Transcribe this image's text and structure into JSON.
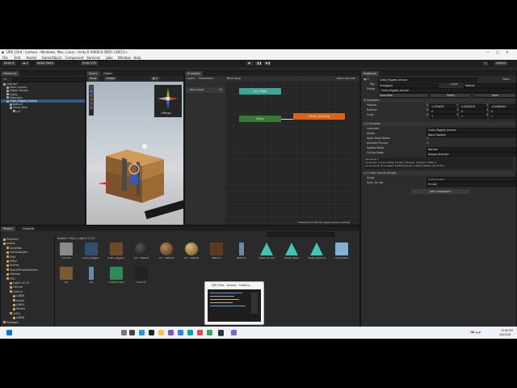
{
  "window": {
    "title": "URP_03rd - Lecture - Windows, Mac, Linux - Unity 6 (6000.0.58f2) <DX11>",
    "menus": [
      "File",
      "Edit",
      "Assets",
      "GameObject",
      "Component",
      "Services",
      "Jobs",
      "Window",
      "Help"
    ]
  },
  "toolbar": {
    "account": "Unity 6",
    "asset_store": "Asset Store",
    "unity_version_control": "Unity VCS",
    "layout": "Layout"
  },
  "hierarchy": {
    "tab": "Hierarchy",
    "items": [
      {
        "label": "Lecture*",
        "indent": 0,
        "selected": false
      },
      {
        "label": "Main Camera",
        "indent": 1,
        "selected": false
      },
      {
        "label": "Global Volume",
        "indent": 1,
        "selected": false
      },
      {
        "label": "Lights",
        "indent": 1,
        "selected": false
      },
      {
        "label": "Geometry",
        "indent": 1,
        "selected": false
      },
      {
        "label": "Crate_Rigged_lecture",
        "indent": 1,
        "selected": true
      },
      {
        "label": "Bottom",
        "indent": 2,
        "selected": false
      },
      {
        "label": "Chest_Root",
        "indent": 2,
        "selected": false
      },
      {
        "label": "Lid",
        "indent": 3,
        "selected": false
      }
    ]
  },
  "scene": {
    "tabs": [
      "Scene",
      "Game"
    ],
    "pivot": "Pivot",
    "global": "Global",
    "persp": "<Persp"
  },
  "animator": {
    "tab": "Animator",
    "subtabs": [
      "Layers",
      "Parameters"
    ],
    "base_layer": "Base Layer",
    "base_layer_item": "Base Layer",
    "auto_live_link": "Auto Live Link",
    "nodes": {
      "any_state": "Any State",
      "entry": "Entry",
      "chest_opening": "Chest_Opening"
    },
    "footer_path": "VSA/Lab15-12-12/Crate_Rigged_lecture.controller"
  },
  "inspector": {
    "tab": "Inspector",
    "object_name": "Crate_Rigged_lecture",
    "static": "Static",
    "tag_label": "Tag",
    "tag_value": "Untagged",
    "layer_label": "Layer",
    "layer_value": "Default",
    "prefab_label": "Prefab",
    "prefab_value": "Crate_Rigged_lecture",
    "overrides": "Overrides",
    "select": "Select",
    "open": "Open",
    "transform": {
      "header": "Transform",
      "position": {
        "label": "Position",
        "x": "1.570639",
        "y": "0.0000039",
        "z": "-0.0489649"
      },
      "rotation": {
        "label": "Rotation",
        "x": "0",
        "y": "0",
        "z": "0"
      },
      "scale": {
        "label": "Scale",
        "x": "1",
        "y": "1",
        "z": "1"
      }
    },
    "animator_comp": {
      "header": "Animator",
      "controller": {
        "label": "Controller",
        "value": "Crate_Rigged_lecture"
      },
      "avatar": {
        "label": "Avatar",
        "value": "None (Avatar)"
      },
      "apply_root_motion": "Apply Root Motion",
      "animate_physics": "Animate Physics",
      "update_mode": {
        "label": "Update Mode",
        "value": "Normal"
      },
      "culling_mode": {
        "label": "Culling Mode",
        "value": "Always Animate"
      },
      "clip_info": "Clip Count: 1\nCurves Pos: 0 Quat: 0 Euler: 0 Scale: 0 Muscles: 0 Generic: 0 PPtr: 0\nCurves Count: 32 Constant: 8 (66.8%) Dense: 0 (0.0%) Stream: 24 (33.3%)"
    },
    "script_comp": {
      "header": "Crate Control (Script)",
      "script": {
        "label": "Script",
        "value": "CrateControl"
      },
      "anim_on_act": {
        "label": "Anim_On Act",
        "value": "On Act"
      }
    },
    "add_component": "Add Component"
  },
  "project": {
    "tabs": [
      "Project",
      "Console"
    ],
    "tree": [
      {
        "label": "Favorites",
        "indent": 0
      },
      {
        "label": "Assets",
        "indent": 0
      },
      {
        "label": "AzureTool",
        "indent": 1
      },
      {
        "label": "ConvexAssets",
        "indent": 1
      },
      {
        "label": "Shot",
        "indent": 1
      },
      {
        "label": "Editor",
        "indent": 1
      },
      {
        "label": "Scenes",
        "indent": 1
      },
      {
        "label": "SpaceTemplateAssets",
        "indent": 1
      },
      {
        "label": "Settings",
        "indent": 1
      },
      {
        "label": "VSA",
        "indent": 1
      },
      {
        "label": "Lab15-12-12",
        "indent": 2
      },
      {
        "label": "Lecture",
        "indent": 2
      },
      {
        "label": "Lecture",
        "indent": 2
      },
      {
        "label": "LAB09",
        "indent": 3
      },
      {
        "label": "Assets",
        "indent": 3
      },
      {
        "label": "LAB09",
        "indent": 3
      },
      {
        "label": "Models",
        "indent": 3
      },
      {
        "label": "Lab11",
        "indent": 2
      },
      {
        "label": "LAB08",
        "indent": 3
      },
      {
        "label": "Packages",
        "indent": 0
      }
    ],
    "breadcrumb": "Assets > VSA > Lab15-12-12",
    "assets": [
      {
        "label": "Lecture",
        "kind": "folder"
      },
      {
        "label": "Crate_Rigged...",
        "kind": "prefab"
      },
      {
        "label": "Crate_Rigged...",
        "kind": "model"
      },
      {
        "label": "Lid - Default",
        "kind": "mat-dark"
      },
      {
        "label": "Lid - Default",
        "kind": "mat-brown"
      },
      {
        "label": "Lid - Default",
        "kind": "mat-tan"
      },
      {
        "label": "Bottom",
        "kind": "mesh"
      },
      {
        "label": "Bottom",
        "kind": "mesh-bar"
      },
      {
        "label": "Chest_Closed",
        "kind": "anim"
      },
      {
        "label": "Chest_Open",
        "kind": "anim"
      },
      {
        "label": "Chest_Opening",
        "kind": "anim"
      },
      {
        "label": "Chest_Root",
        "kind": "cube"
      },
      {
        "label": "Lid",
        "kind": "mesh-lid"
      },
      {
        "label": "Lid",
        "kind": "mesh-bar"
      },
      {
        "label": "CrateControl",
        "kind": "script"
      },
      {
        "label": "Lecture",
        "kind": "unity"
      }
    ]
  },
  "preview_popup": {
    "title": "URP_03rd - Lecture - CrateCo..."
  },
  "tray": {
    "time": "10:06 PM",
    "date": "4/8/2026"
  },
  "colors": {
    "entry_node": "#2e7d32",
    "any_state_node": "#3aa894",
    "state_node": "#d9641c",
    "selection": "#2c5d87"
  }
}
